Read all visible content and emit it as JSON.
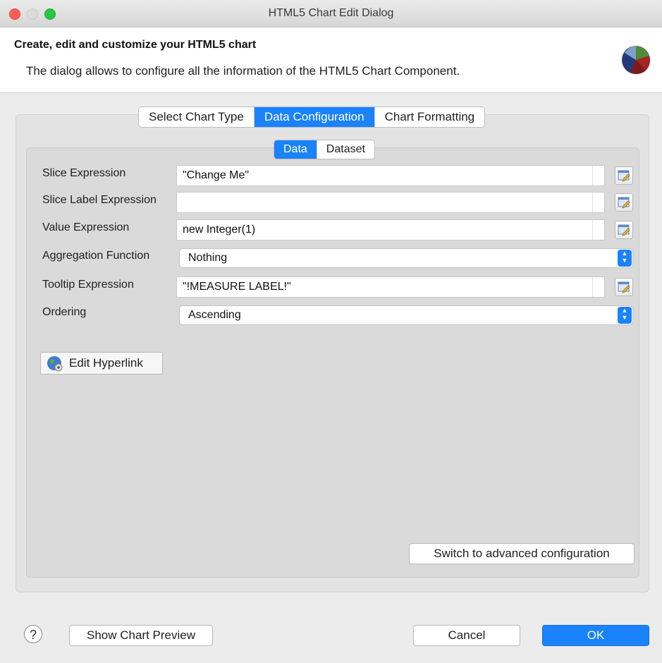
{
  "window": {
    "title": "HTML5 Chart Edit Dialog"
  },
  "header": {
    "title": "Create, edit and customize your HTML5 chart",
    "description": "The dialog allows to configure all the information of the HTML5 Chart Component.",
    "logo_icon": "pie-chart-icon"
  },
  "main_tabs": [
    {
      "label": "Select Chart Type",
      "active": false
    },
    {
      "label": "Data Configuration",
      "active": true
    },
    {
      "label": "Chart Formatting",
      "active": false
    }
  ],
  "sub_tabs": [
    {
      "label": "Data",
      "active": true
    },
    {
      "label": "Dataset",
      "active": false
    }
  ],
  "form": {
    "slice_expression": {
      "label": "Slice Expression",
      "value": "\"Change Me\""
    },
    "slice_label_expression": {
      "label": "Slice Label Expression",
      "value": ""
    },
    "value_expression": {
      "label": "Value Expression",
      "value": "new Integer(1)"
    },
    "aggregation_function": {
      "label": "Aggregation Function",
      "value": "Nothing"
    },
    "tooltip_expression": {
      "label": "Tooltip Expression",
      "value": "\"!MEASURE LABEL!\""
    },
    "ordering": {
      "label": "Ordering",
      "value": "Ascending"
    }
  },
  "buttons": {
    "edit_hyperlink": "Edit Hyperlink",
    "switch_advanced": "Switch to advanced configuration",
    "help": "?",
    "show_preview": "Show Chart Preview",
    "cancel": "Cancel",
    "ok": "OK"
  },
  "colors": {
    "accent": "#1a82fb",
    "close": "#fd5f57",
    "maximize": "#28c840"
  }
}
